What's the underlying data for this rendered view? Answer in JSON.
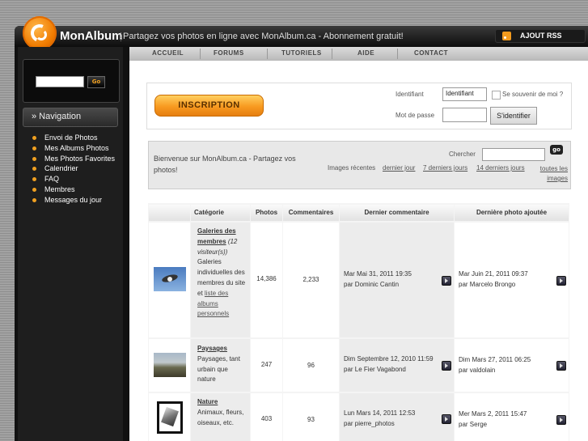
{
  "header": {
    "brand": "MonAlbum",
    "tagline": "Partagez vos photos en ligne avec MonAlbum.ca - Abonnement gratuit!",
    "rss_label": "AJOUT RSS"
  },
  "nav": {
    "items": [
      "ACCUEIL",
      "FORUMS",
      "TUTORIELS",
      "AIDE",
      "CONTACT"
    ]
  },
  "sidebar": {
    "go_label": "Go",
    "navigation_title": "» Navigation",
    "items": [
      "Envoi de Photos",
      "Mes Albums Photos",
      "Mes Photos Favorites",
      "Calendrier",
      "FAQ",
      "Membres",
      "Messages du jour"
    ]
  },
  "login": {
    "inscription_label": "INSCRIPTION",
    "identifiant_label": "Identifiant",
    "identifiant_value": "Identifiant",
    "remember_label": "Se souvenir de moi ?",
    "password_label": "Mot de passe",
    "submit_label": "S'identifier"
  },
  "welcome": {
    "text": "Bienvenue sur MonAlbum.ca - Partagez vos photos!",
    "search_label": "Chercher",
    "go_label": "go",
    "recent_label": "Images récentes",
    "recent_links": [
      "dernier jour",
      "7 derniers jours",
      "14 derniers jours",
      "toutes les images"
    ]
  },
  "table": {
    "headers": [
      "Catégorie",
      "Photos",
      "Commentaires",
      "Dernier commentaire",
      "Dernière photo ajoutée"
    ],
    "rows": [
      {
        "title": "Galeries des membres",
        "visitors": "(12 visiteur(s))",
        "desc": "Galeries individuelles des membres du site et",
        "link": "liste des albums personnels",
        "photos": "14,386",
        "comments": "2,233",
        "last_comment_date": "Mar Mai 31, 2011 19:35",
        "last_comment_by": "par Dominic Cantin",
        "last_photo_date": "Mar Juin 21, 2011 09:37",
        "last_photo_by": "par Marcelo Brongo"
      },
      {
        "title": "Paysages",
        "desc": "Paysages, tant urbain que nature",
        "photos": "247",
        "comments": "96",
        "last_comment_date": "Dim Septembre 12, 2010 11:59",
        "last_comment_by": "par Le Fier Vagabond",
        "last_photo_date": "Dim Mars 27, 2011 06:25",
        "last_photo_by": "par valdolain"
      },
      {
        "title": "Nature",
        "desc": "Animaux, fleurs, oiseaux, etc.",
        "photos": "403",
        "comments": "93",
        "last_comment_date": "Lun Mars 14, 2011 12:53",
        "last_comment_by": "par pierre_photos",
        "last_photo_date": "Mer Mars 2, 2011 15:47",
        "last_photo_by": "par Serge"
      }
    ]
  }
}
